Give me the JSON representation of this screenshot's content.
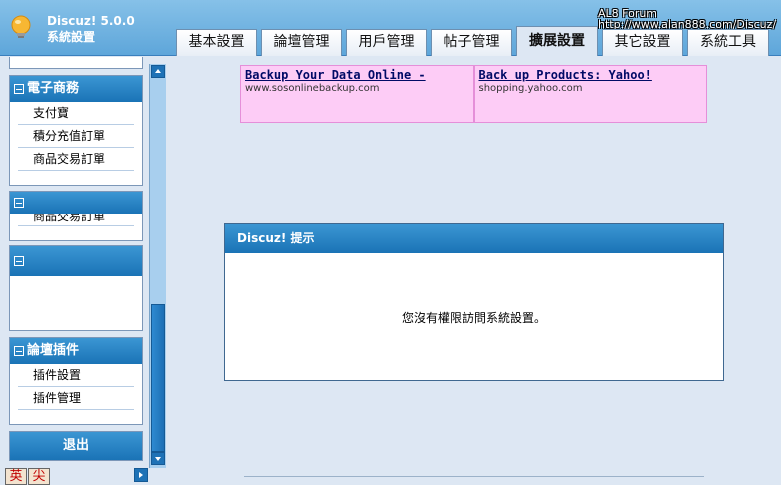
{
  "header": {
    "brand_line1": "Discuz! 5.0.0",
    "brand_line2": "系統設置",
    "watermark_line1": "AL8 Forum",
    "watermark_line2": "http://www.alan888.com/Discuz/"
  },
  "tabs": [
    {
      "label": "基本設置",
      "active": false
    },
    {
      "label": "論壇管理",
      "active": false
    },
    {
      "label": "用戶管理",
      "active": false
    },
    {
      "label": "帖子管理",
      "active": false
    },
    {
      "label": "擴展設置",
      "active": true
    },
    {
      "label": "其它設置",
      "active": false
    },
    {
      "label": "系統工具",
      "active": false
    }
  ],
  "sidebar": {
    "panel_ecommerce": {
      "title": "電子商務",
      "items": [
        "支付寶",
        "積分充值訂單",
        "商品交易訂單"
      ]
    },
    "panel_collapsed_partial_item": "商品交易訂單",
    "panel_plugins": {
      "title": "論壇插件",
      "items": [
        "插件設置",
        "插件管理"
      ]
    },
    "logout_label": "退出",
    "lang_buttons": [
      "英",
      "尖"
    ]
  },
  "ads": [
    {
      "title": "Backup Your Data Online -",
      "url": "www.sosonlinebackup.com"
    },
    {
      "title": "Back up Products: Yahoo!",
      "url": "shopping.yahoo.com"
    }
  ],
  "notice": {
    "title": "Discuz! 提示",
    "message": "您沒有權限訪問系統設置。"
  },
  "colors": {
    "header_bg": "#6fb2e0",
    "panel_head": "#1f7ac0",
    "content_bg": "#dde7f3",
    "ad_bg": "#fdccf6"
  }
}
